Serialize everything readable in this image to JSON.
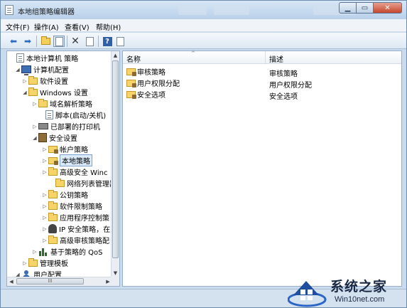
{
  "window": {
    "title": "本地组策略编辑器"
  },
  "menu": [
    {
      "label": "文件(F)"
    },
    {
      "label": "操作(A)"
    },
    {
      "label": "查看(V)"
    },
    {
      "label": "帮助(H)"
    }
  ],
  "toolbar": {
    "icons": [
      "back-arrow-icon",
      "forward-arrow-icon",
      "up-folder-icon",
      "show-hide-tree-icon",
      "delete-icon",
      "export-list-icon",
      "help-icon",
      "properties-icon"
    ]
  },
  "tree": [
    {
      "label": "本地计算机 策略",
      "icon": "doc",
      "arrow": ""
    },
    {
      "label": "计算机配置",
      "icon": "computer",
      "arrow": "◢"
    },
    {
      "label": "软件设置",
      "icon": "folder",
      "arrow": "▷"
    },
    {
      "label": "Windows 设置",
      "icon": "folder",
      "arrow": "◢"
    },
    {
      "label": "域名解析策略",
      "icon": "folder",
      "arrow": "▷"
    },
    {
      "label": "脚本(启动/关机)",
      "icon": "doc",
      "arrow": ""
    },
    {
      "label": "已部署的打印机",
      "icon": "printer",
      "arrow": "▷"
    },
    {
      "label": "安全设置",
      "icon": "shield",
      "arrow": "◢"
    },
    {
      "label": "帐户策略",
      "icon": "lockfolder",
      "arrow": "▷"
    },
    {
      "label": "本地策略",
      "icon": "lockfolder",
      "arrow": "▷",
      "selected": true
    },
    {
      "label": "高级安全 Winc",
      "icon": "folder",
      "arrow": "▷"
    },
    {
      "label": "网络列表管理器",
      "icon": "folder",
      "arrow": ""
    },
    {
      "label": "公钥策略",
      "icon": "folder",
      "arrow": "▷"
    },
    {
      "label": "软件限制策略",
      "icon": "folder",
      "arrow": "▷"
    },
    {
      "label": "应用程序控制策",
      "icon": "folder",
      "arrow": "▷"
    },
    {
      "label": "IP 安全策略，在",
      "icon": "ipsec",
      "arrow": "▷"
    },
    {
      "label": "高级审核策略配",
      "icon": "folder",
      "arrow": "▷"
    },
    {
      "label": "基于策略的 QoS",
      "icon": "chart",
      "arrow": "▷"
    },
    {
      "label": "管理模板",
      "icon": "folder",
      "arrow": "▷"
    },
    {
      "label": "用户配置",
      "icon": "user",
      "arrow": "◢"
    }
  ],
  "list": {
    "columns": {
      "name": "名称",
      "desc": "描述"
    },
    "rows": [
      {
        "name": "审核策略",
        "desc": "审核策略"
      },
      {
        "name": "用户权限分配",
        "desc": "用户权限分配"
      },
      {
        "name": "安全选项",
        "desc": "安全选项"
      }
    ]
  },
  "scroll": {
    "h_thumb_grip": "III"
  },
  "watermark": {
    "brand": "系统之家",
    "url": "Win10net.com"
  }
}
